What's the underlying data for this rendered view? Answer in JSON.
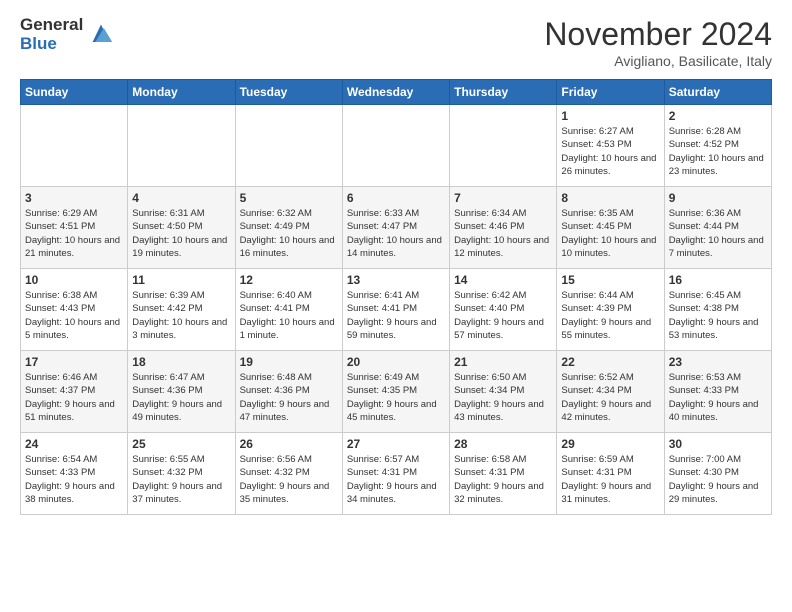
{
  "logo": {
    "general": "General",
    "blue": "Blue"
  },
  "title": "November 2024",
  "location": "Avigliano, Basilicate, Italy",
  "weekdays": [
    "Sunday",
    "Monday",
    "Tuesday",
    "Wednesday",
    "Thursday",
    "Friday",
    "Saturday"
  ],
  "weeks": [
    [
      {
        "day": "",
        "info": ""
      },
      {
        "day": "",
        "info": ""
      },
      {
        "day": "",
        "info": ""
      },
      {
        "day": "",
        "info": ""
      },
      {
        "day": "",
        "info": ""
      },
      {
        "day": "1",
        "info": "Sunrise: 6:27 AM\nSunset: 4:53 PM\nDaylight: 10 hours and 26 minutes."
      },
      {
        "day": "2",
        "info": "Sunrise: 6:28 AM\nSunset: 4:52 PM\nDaylight: 10 hours and 23 minutes."
      }
    ],
    [
      {
        "day": "3",
        "info": "Sunrise: 6:29 AM\nSunset: 4:51 PM\nDaylight: 10 hours and 21 minutes."
      },
      {
        "day": "4",
        "info": "Sunrise: 6:31 AM\nSunset: 4:50 PM\nDaylight: 10 hours and 19 minutes."
      },
      {
        "day": "5",
        "info": "Sunrise: 6:32 AM\nSunset: 4:49 PM\nDaylight: 10 hours and 16 minutes."
      },
      {
        "day": "6",
        "info": "Sunrise: 6:33 AM\nSunset: 4:47 PM\nDaylight: 10 hours and 14 minutes."
      },
      {
        "day": "7",
        "info": "Sunrise: 6:34 AM\nSunset: 4:46 PM\nDaylight: 10 hours and 12 minutes."
      },
      {
        "day": "8",
        "info": "Sunrise: 6:35 AM\nSunset: 4:45 PM\nDaylight: 10 hours and 10 minutes."
      },
      {
        "day": "9",
        "info": "Sunrise: 6:36 AM\nSunset: 4:44 PM\nDaylight: 10 hours and 7 minutes."
      }
    ],
    [
      {
        "day": "10",
        "info": "Sunrise: 6:38 AM\nSunset: 4:43 PM\nDaylight: 10 hours and 5 minutes."
      },
      {
        "day": "11",
        "info": "Sunrise: 6:39 AM\nSunset: 4:42 PM\nDaylight: 10 hours and 3 minutes."
      },
      {
        "day": "12",
        "info": "Sunrise: 6:40 AM\nSunset: 4:41 PM\nDaylight: 10 hours and 1 minute."
      },
      {
        "day": "13",
        "info": "Sunrise: 6:41 AM\nSunset: 4:41 PM\nDaylight: 9 hours and 59 minutes."
      },
      {
        "day": "14",
        "info": "Sunrise: 6:42 AM\nSunset: 4:40 PM\nDaylight: 9 hours and 57 minutes."
      },
      {
        "day": "15",
        "info": "Sunrise: 6:44 AM\nSunset: 4:39 PM\nDaylight: 9 hours and 55 minutes."
      },
      {
        "day": "16",
        "info": "Sunrise: 6:45 AM\nSunset: 4:38 PM\nDaylight: 9 hours and 53 minutes."
      }
    ],
    [
      {
        "day": "17",
        "info": "Sunrise: 6:46 AM\nSunset: 4:37 PM\nDaylight: 9 hours and 51 minutes."
      },
      {
        "day": "18",
        "info": "Sunrise: 6:47 AM\nSunset: 4:36 PM\nDaylight: 9 hours and 49 minutes."
      },
      {
        "day": "19",
        "info": "Sunrise: 6:48 AM\nSunset: 4:36 PM\nDaylight: 9 hours and 47 minutes."
      },
      {
        "day": "20",
        "info": "Sunrise: 6:49 AM\nSunset: 4:35 PM\nDaylight: 9 hours and 45 minutes."
      },
      {
        "day": "21",
        "info": "Sunrise: 6:50 AM\nSunset: 4:34 PM\nDaylight: 9 hours and 43 minutes."
      },
      {
        "day": "22",
        "info": "Sunrise: 6:52 AM\nSunset: 4:34 PM\nDaylight: 9 hours and 42 minutes."
      },
      {
        "day": "23",
        "info": "Sunrise: 6:53 AM\nSunset: 4:33 PM\nDaylight: 9 hours and 40 minutes."
      }
    ],
    [
      {
        "day": "24",
        "info": "Sunrise: 6:54 AM\nSunset: 4:33 PM\nDaylight: 9 hours and 38 minutes."
      },
      {
        "day": "25",
        "info": "Sunrise: 6:55 AM\nSunset: 4:32 PM\nDaylight: 9 hours and 37 minutes."
      },
      {
        "day": "26",
        "info": "Sunrise: 6:56 AM\nSunset: 4:32 PM\nDaylight: 9 hours and 35 minutes."
      },
      {
        "day": "27",
        "info": "Sunrise: 6:57 AM\nSunset: 4:31 PM\nDaylight: 9 hours and 34 minutes."
      },
      {
        "day": "28",
        "info": "Sunrise: 6:58 AM\nSunset: 4:31 PM\nDaylight: 9 hours and 32 minutes."
      },
      {
        "day": "29",
        "info": "Sunrise: 6:59 AM\nSunset: 4:31 PM\nDaylight: 9 hours and 31 minutes."
      },
      {
        "day": "30",
        "info": "Sunrise: 7:00 AM\nSunset: 4:30 PM\nDaylight: 9 hours and 29 minutes."
      }
    ]
  ]
}
